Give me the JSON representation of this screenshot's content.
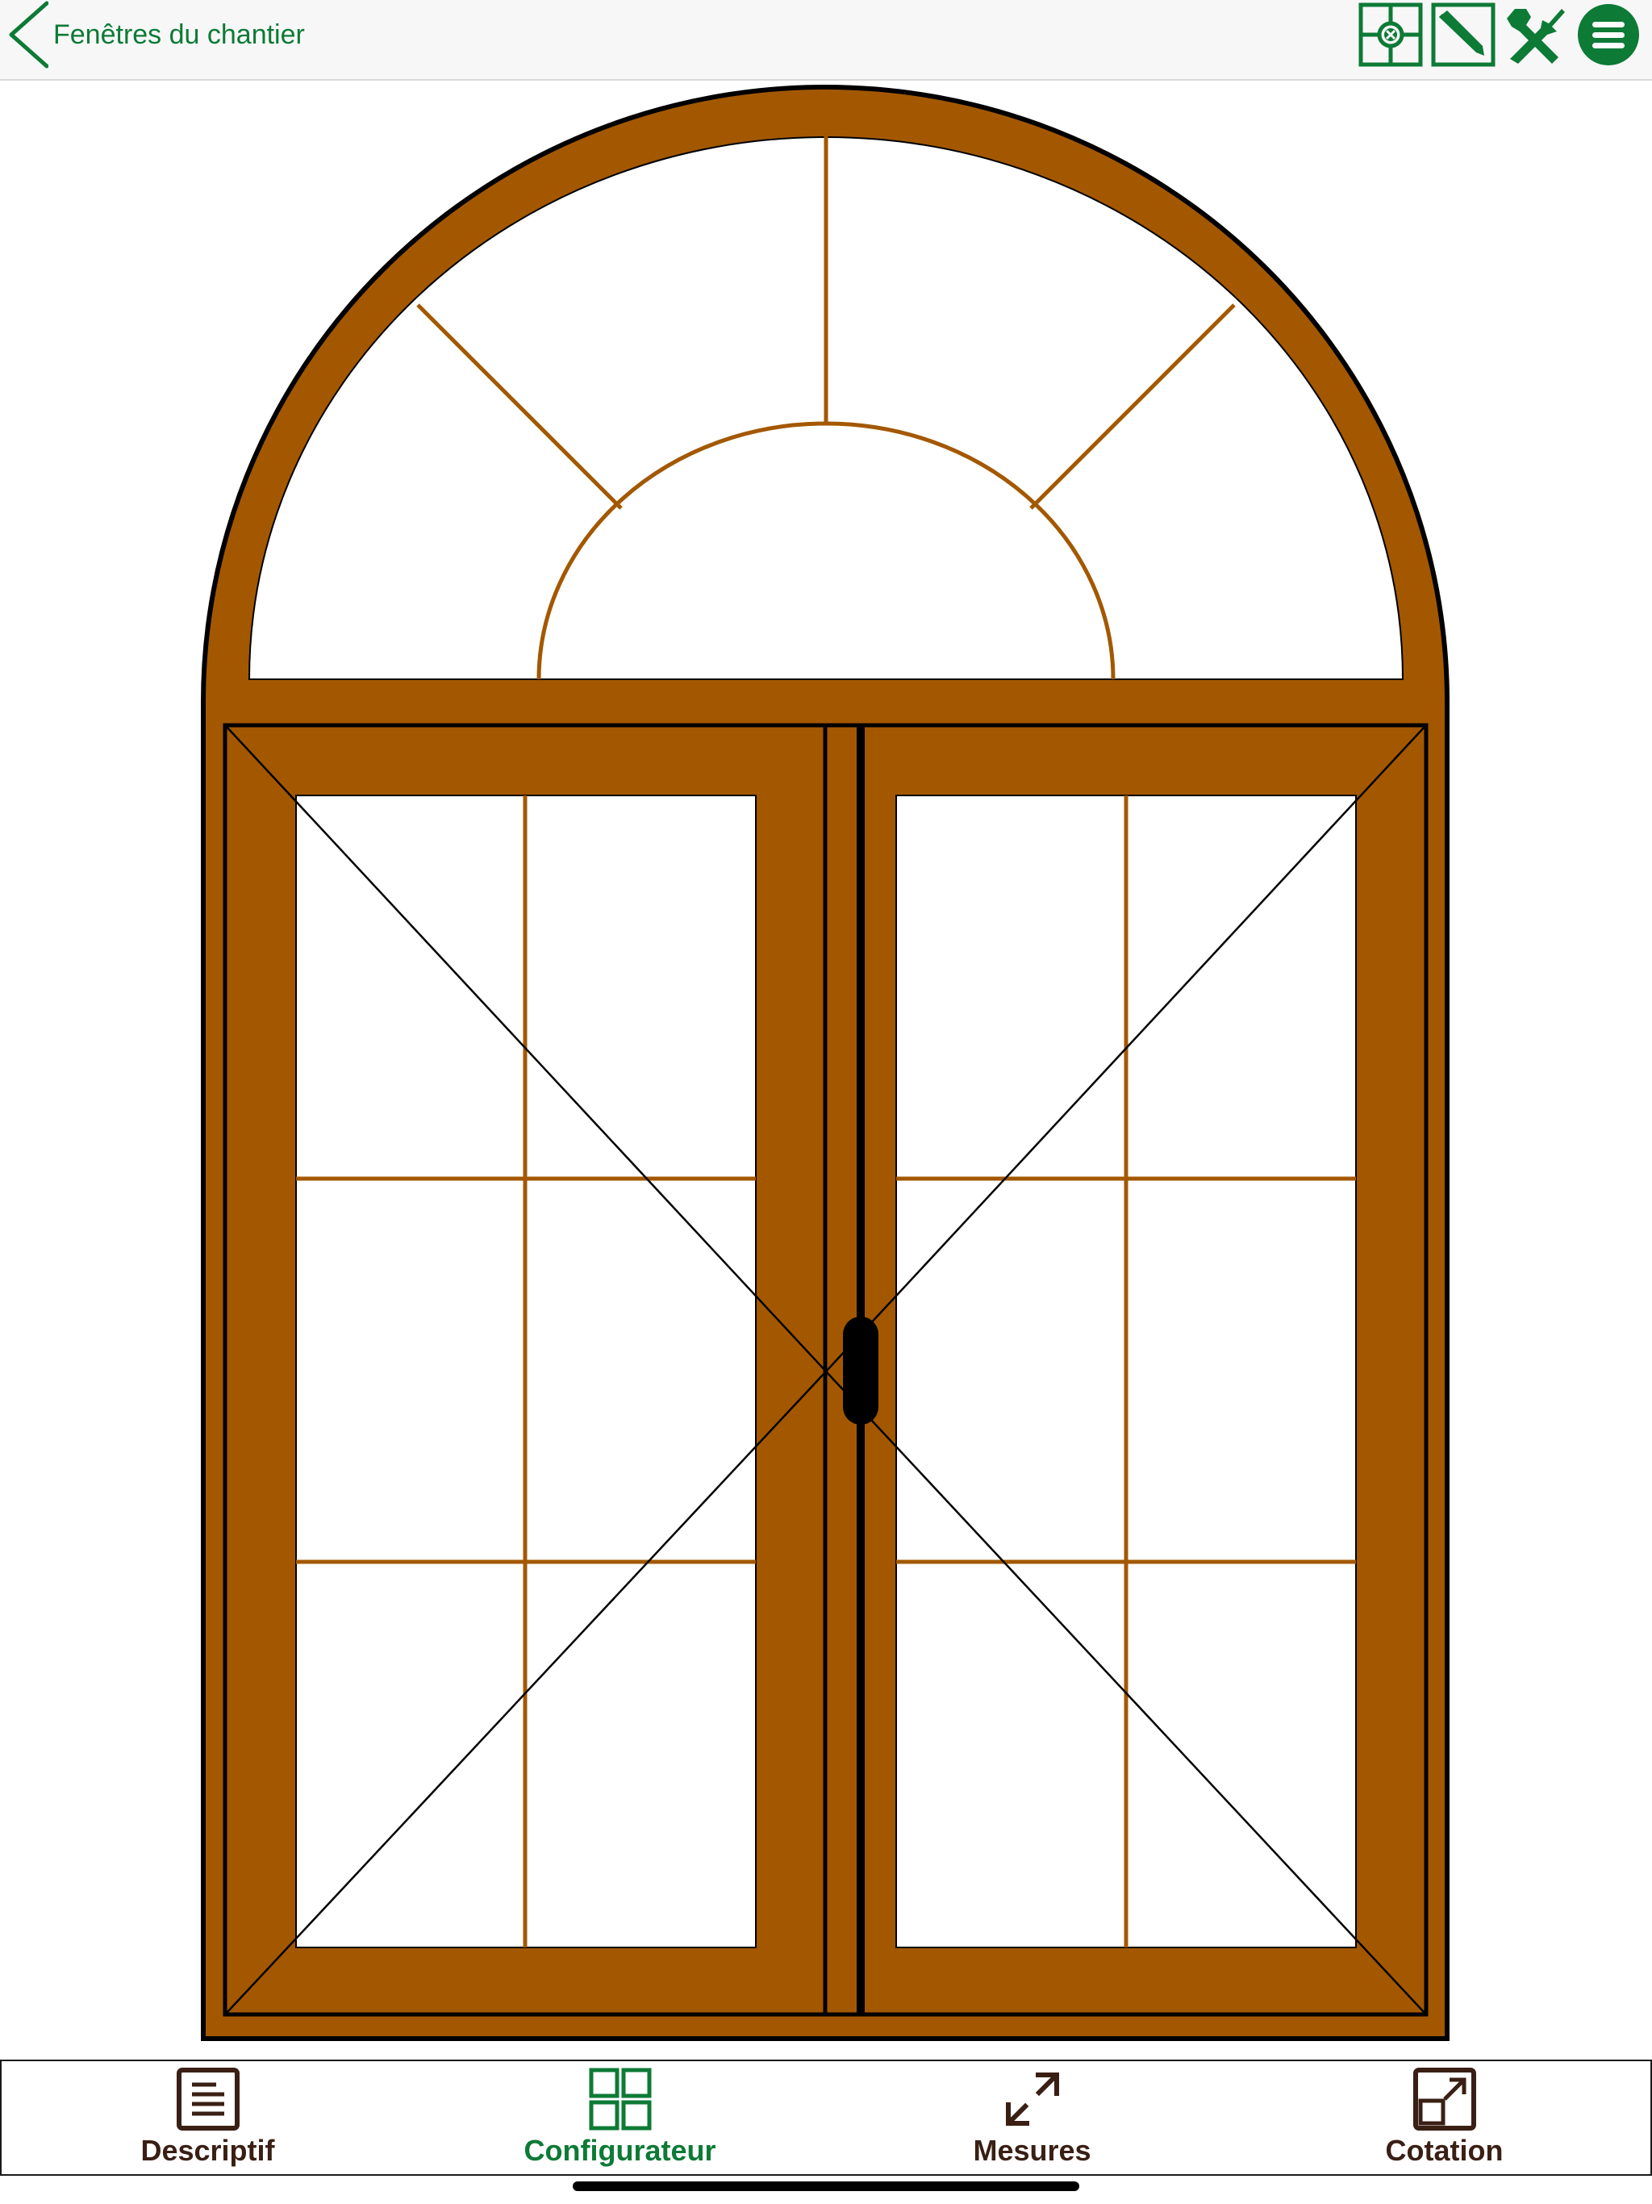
{
  "header": {
    "back_label": "Fenêtres du chantier",
    "tools": [
      "target-icon",
      "edit-icon",
      "tools-icon",
      "menu-icon"
    ]
  },
  "window": {
    "frame_color": "#A35800",
    "outline_color": "#000000",
    "glass_color": "#ffffff",
    "sashes": 2,
    "panes_per_sash": {
      "columns": 2,
      "rows": 3
    },
    "transom": "semicircular-arch-with-sunburst"
  },
  "tabs": [
    {
      "label": "Descriptif",
      "icon": "document-icon",
      "active": false
    },
    {
      "label": "Configurateur",
      "icon": "grid-icon",
      "active": true
    },
    {
      "label": "Mesures",
      "icon": "resize-arrows-icon",
      "active": false
    },
    {
      "label": "Cotation",
      "icon": "expand-box-icon",
      "active": false
    }
  ],
  "colors": {
    "accent": "#0d7a36",
    "tab_inactive": "#3a1f14",
    "tab_active": "#0d7a36"
  }
}
